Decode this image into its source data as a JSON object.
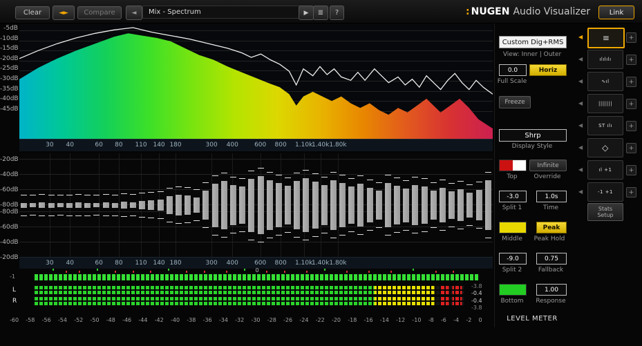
{
  "toolbar": {
    "clear": "Clear",
    "compare": "Compare",
    "preset": "Mix - Spectrum",
    "link": "Link",
    "brand": {
      "dots": ":",
      "name": "NUGEN",
      "product": "Audio Visualizer"
    },
    "icons": {
      "swap": "◄►",
      "prev": "◄",
      "play": "▶",
      "list": "≣",
      "help": "?"
    }
  },
  "spectrum": {
    "db_labels": [
      "-5dB",
      "-10dB",
      "-15dB",
      "-20dB",
      "-25dB",
      "-30dB",
      "-35dB",
      "-40dB",
      "-45dB"
    ],
    "freq_labels": [
      {
        "t": "30",
        "p": 6.4
      },
      {
        "t": "40",
        "p": 10.7
      },
      {
        "t": "60",
        "p": 16.8
      },
      {
        "t": "80",
        "p": 21.0
      },
      {
        "t": "110",
        "p": 25.7
      },
      {
        "t": "140",
        "p": 29.5
      },
      {
        "t": "180",
        "p": 33.0
      },
      {
        "t": "300",
        "p": 40.6
      },
      {
        "t": "400",
        "p": 45.0
      },
      {
        "t": "600",
        "p": 50.9
      },
      {
        "t": "800",
        "p": 55.2
      },
      {
        "t": "1.10k",
        "p": 60.1
      },
      {
        "t": "1.40k",
        "p": 63.6
      },
      {
        "t": "1.80k",
        "p": 67.3
      }
    ],
    "gradient": [
      "#00b4c8",
      "#00c896",
      "#14d05a",
      "#3ce028",
      "#78e410",
      "#b4e400",
      "#dcd800",
      "#e8b400",
      "#e88600",
      "#e25a1e",
      "#d83232",
      "#cc2050"
    ],
    "fill_points": [
      [
        0,
        0.52
      ],
      [
        0.04,
        0.62
      ],
      [
        0.08,
        0.7
      ],
      [
        0.12,
        0.77
      ],
      [
        0.16,
        0.83
      ],
      [
        0.2,
        0.89
      ],
      [
        0.23,
        0.92
      ],
      [
        0.26,
        0.9
      ],
      [
        0.29,
        0.88
      ],
      [
        0.32,
        0.85
      ],
      [
        0.35,
        0.79
      ],
      [
        0.38,
        0.73
      ],
      [
        0.41,
        0.69
      ],
      [
        0.44,
        0.63
      ],
      [
        0.47,
        0.58
      ],
      [
        0.5,
        0.53
      ],
      [
        0.53,
        0.48
      ],
      [
        0.55,
        0.45
      ],
      [
        0.57,
        0.39
      ],
      [
        0.585,
        0.29
      ],
      [
        0.6,
        0.37
      ],
      [
        0.62,
        0.41
      ],
      [
        0.64,
        0.37
      ],
      [
        0.66,
        0.33
      ],
      [
        0.68,
        0.37
      ],
      [
        0.7,
        0.31
      ],
      [
        0.72,
        0.27
      ],
      [
        0.74,
        0.31
      ],
      [
        0.76,
        0.25
      ],
      [
        0.78,
        0.21
      ],
      [
        0.8,
        0.27
      ],
      [
        0.82,
        0.23
      ],
      [
        0.84,
        0.29
      ],
      [
        0.86,
        0.35
      ],
      [
        0.875,
        0.29
      ],
      [
        0.89,
        0.23
      ],
      [
        0.91,
        0.29
      ],
      [
        0.93,
        0.35
      ],
      [
        0.95,
        0.27
      ],
      [
        0.97,
        0.17
      ],
      [
        1,
        0.09
      ]
    ],
    "line_points": [
      [
        0,
        0.7
      ],
      [
        0.04,
        0.77
      ],
      [
        0.08,
        0.83
      ],
      [
        0.12,
        0.88
      ],
      [
        0.16,
        0.92
      ],
      [
        0.2,
        0.95
      ],
      [
        0.24,
        0.97
      ],
      [
        0.28,
        0.93
      ],
      [
        0.32,
        0.9
      ],
      [
        0.36,
        0.87
      ],
      [
        0.4,
        0.83
      ],
      [
        0.44,
        0.79
      ],
      [
        0.47,
        0.75
      ],
      [
        0.49,
        0.71
      ],
      [
        0.51,
        0.74
      ],
      [
        0.53,
        0.69
      ],
      [
        0.55,
        0.65
      ],
      [
        0.57,
        0.59
      ],
      [
        0.585,
        0.47
      ],
      [
        0.6,
        0.61
      ],
      [
        0.62,
        0.55
      ],
      [
        0.635,
        0.63
      ],
      [
        0.65,
        0.56
      ],
      [
        0.665,
        0.61
      ],
      [
        0.68,
        0.54
      ],
      [
        0.7,
        0.51
      ],
      [
        0.715,
        0.58
      ],
      [
        0.73,
        0.51
      ],
      [
        0.75,
        0.61
      ],
      [
        0.765,
        0.55
      ],
      [
        0.78,
        0.49
      ],
      [
        0.8,
        0.54
      ],
      [
        0.815,
        0.47
      ],
      [
        0.83,
        0.52
      ],
      [
        0.845,
        0.45
      ],
      [
        0.86,
        0.55
      ],
      [
        0.875,
        0.49
      ],
      [
        0.89,
        0.43
      ],
      [
        0.905,
        0.51
      ],
      [
        0.92,
        0.57
      ],
      [
        0.935,
        0.49
      ],
      [
        0.95,
        0.43
      ],
      [
        0.965,
        0.51
      ],
      [
        0.98,
        0.45
      ],
      [
        1,
        0.39
      ]
    ]
  },
  "histogram": {
    "db_labels": [
      "-20dB",
      "-40dB",
      "-60dB",
      "-80dB",
      "-80dB",
      "-60dB",
      "-40dB",
      "-20dB"
    ],
    "freq_labels": [
      {
        "t": "30",
        "p": 6.4
      },
      {
        "t": "40",
        "p": 10.7
      },
      {
        "t": "60",
        "p": 16.8
      },
      {
        "t": "80",
        "p": 21.0
      },
      {
        "t": "110",
        "p": 25.7
      },
      {
        "t": "140",
        "p": 29.5
      },
      {
        "t": "180",
        "p": 33.0
      },
      {
        "t": "300",
        "p": 40.6
      },
      {
        "t": "400",
        "p": 45.0
      },
      {
        "t": "600",
        "p": 50.9
      },
      {
        "t": "800",
        "p": 55.2
      },
      {
        "t": "1.10k",
        "p": 60.1
      },
      {
        "t": "1.40k",
        "p": 63.6
      },
      {
        "t": "1.80k",
        "p": 67.3
      }
    ],
    "bar_color": "#9c9c9c",
    "peak_color": "#e0e0e0",
    "bars": [
      0.05,
      0.04,
      0.06,
      0.05,
      0.04,
      0.05,
      0.06,
      0.05,
      0.04,
      0.06,
      0.05,
      0.07,
      0.06,
      0.08,
      0.1,
      0.12,
      0.18,
      0.22,
      0.2,
      0.16,
      0.3,
      0.45,
      0.5,
      0.42,
      0.38,
      0.55,
      0.6,
      0.52,
      0.46,
      0.4,
      0.5,
      0.56,
      0.48,
      0.42,
      0.52,
      0.46,
      0.38,
      0.44,
      0.36,
      0.3,
      0.46,
      0.4,
      0.35,
      0.42,
      0.38,
      0.3,
      0.36,
      0.28,
      0.33,
      0.26,
      0.31,
      0.52
    ]
  },
  "correlation": {
    "min_label": "-1",
    "zero_label": "0",
    "bar_color": "#35e035",
    "ticks": [
      {
        "p": 4,
        "c": "g"
      },
      {
        "p": 7,
        "c": "r"
      },
      {
        "p": 10,
        "c": "r"
      },
      {
        "p": 14,
        "c": "g"
      },
      {
        "p": 18,
        "c": "r"
      },
      {
        "p": 22,
        "c": "r"
      },
      {
        "p": 26,
        "c": "r"
      },
      {
        "p": 30,
        "c": "g"
      },
      {
        "p": 34,
        "c": "r"
      },
      {
        "p": 38,
        "c": "r"
      },
      {
        "p": 43,
        "c": "r"
      },
      {
        "p": 47,
        "c": "g"
      },
      {
        "p": 52,
        "c": "r"
      },
      {
        "p": 56,
        "c": "r"
      },
      {
        "p": 61,
        "c": "r"
      },
      {
        "p": 65,
        "c": "g"
      },
      {
        "p": 70,
        "c": "r"
      },
      {
        "p": 75,
        "c": "r"
      },
      {
        "p": 80,
        "c": "r"
      },
      {
        "p": 85,
        "c": "g"
      },
      {
        "p": 90,
        "c": "r"
      },
      {
        "p": 94,
        "c": "r"
      }
    ]
  },
  "level_meter": {
    "channel_labels": [
      "L",
      "R"
    ],
    "readouts": [
      "-3.8",
      "-0.4",
      "-0.4",
      "-3.8"
    ],
    "scale": [
      "-60",
      "-58",
      "-56",
      "-54",
      "-52",
      "-50",
      "-48",
      "-46",
      "-44",
      "-42",
      "-40",
      "-38",
      "-36",
      "-34",
      "-32",
      "-30",
      "-28",
      "-26",
      "-24",
      "-22",
      "-20",
      "-18",
      "-16",
      "-14",
      "-12",
      "-10",
      "-8",
      "-6",
      "-4",
      "-2",
      "0"
    ],
    "title": "LEVEL METER",
    "colors": {
      "green": "#2bd42b",
      "yellow": "#e8e000",
      "red": "#e02020"
    },
    "segments": {
      "green_end": 79,
      "yellow_end": 93,
      "red1": [
        94.2,
        96.4
      ],
      "red2": [
        97.2,
        99.4
      ]
    }
  },
  "panel": {
    "preset": "Custom Dig+RMS",
    "view_label": "View: Inner | Outer",
    "full_scale": {
      "value": "0.0",
      "label": "Full Scale"
    },
    "horiz": "Horiz",
    "freeze": "Freeze",
    "display_style": {
      "value": "Shrp",
      "label": "Display Style"
    },
    "top": {
      "label": "Top"
    },
    "override": {
      "button": "Infinite",
      "label": "Override"
    },
    "split1": {
      "value": "-3.0",
      "label": "Split 1"
    },
    "time": {
      "value": "1.0s",
      "label": "Time"
    },
    "middle": {
      "label": "Middle"
    },
    "peak_hold": {
      "button": "Peak",
      "label": "Peak Hold"
    },
    "split2": {
      "value": "-9.0",
      "label": "Split 2"
    },
    "fallback": {
      "value": "0.75",
      "label": "Fallback"
    },
    "bottom": {
      "label": "Bottom"
    },
    "response": {
      "value": "1.00",
      "label": "Response"
    },
    "colors": {
      "top_left": "#cc1111",
      "top_right": "#ffffff",
      "middle": "#e8d800",
      "bottom": "#22cc22"
    }
  },
  "sidebar": {
    "module_arrow": "◀",
    "add_button": "+",
    "stats_setup": "Stats Setup",
    "modules": [
      {
        "name": "spectrum",
        "glyph": "≡",
        "selected": true
      },
      {
        "name": "histogram",
        "glyph": "ılılılı",
        "selected": false
      },
      {
        "name": "spectrogram",
        "glyph": "∿ıl",
        "selected": false
      },
      {
        "name": "bands",
        "glyph": "|||||||",
        "selected": false
      },
      {
        "name": "stereo-bands",
        "glyph": "ST ılı",
        "selected": false
      },
      {
        "name": "vectorscope",
        "glyph": "◇",
        "selected": false
      },
      {
        "name": "loudness",
        "glyph": "ıl +1",
        "selected": false
      },
      {
        "name": "correlation",
        "glyph": "-1 +1",
        "selected": false
      }
    ]
  }
}
